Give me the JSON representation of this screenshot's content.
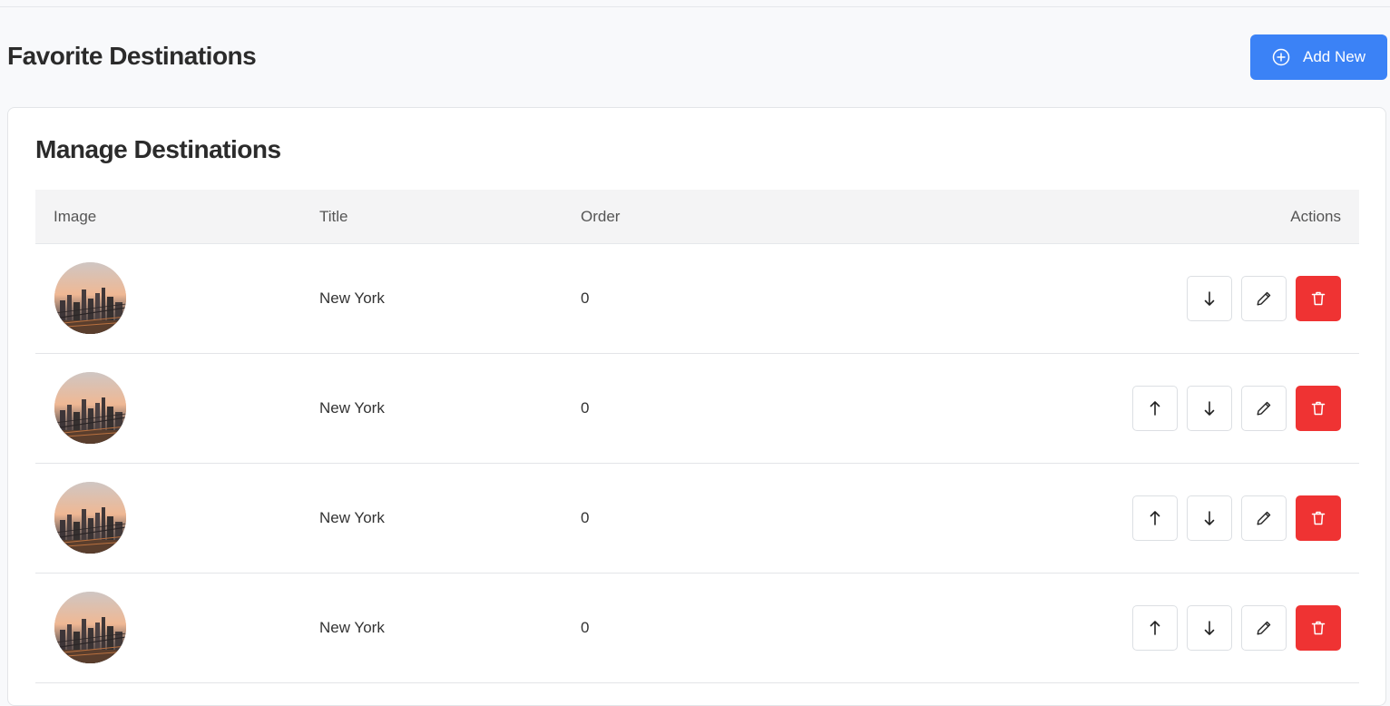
{
  "header": {
    "title": "Favorite Destinations",
    "add_label": "Add New"
  },
  "card": {
    "title": "Manage Destinations"
  },
  "table": {
    "columns": {
      "image": "Image",
      "title": "Title",
      "order": "Order",
      "actions": "Actions"
    },
    "rows": [
      {
        "title": "New York",
        "order": "0",
        "has_move_up": false
      },
      {
        "title": "New York",
        "order": "0",
        "has_move_up": true
      },
      {
        "title": "New York",
        "order": "0",
        "has_move_up": true
      },
      {
        "title": "New York",
        "order": "0",
        "has_move_up": true
      }
    ]
  },
  "icons": {
    "add": "plus-circle-icon",
    "up": "arrow-up-icon",
    "down": "arrow-down-icon",
    "edit": "pencil-icon",
    "delete": "trash-icon"
  },
  "colors": {
    "primary": "#3b82f6",
    "danger": "#ef3333"
  }
}
